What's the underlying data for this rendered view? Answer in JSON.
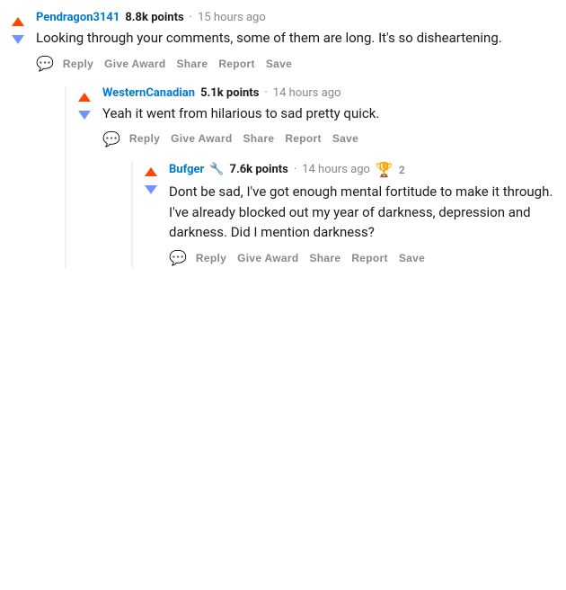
{
  "comments": [
    {
      "id": "comment1",
      "username": "Pendragon3141",
      "points": "8.8k points",
      "dot": "·",
      "timestamp": "15 hours ago",
      "text": "Looking through your comments, some of them are long. It's so disheartening.",
      "actions": [
        "Reply",
        "Give Award",
        "Share",
        "Report",
        "Save"
      ],
      "awards": [],
      "hasTool": false,
      "nested": [
        {
          "id": "comment2",
          "username": "WesternCanadian",
          "points": "5.1k points",
          "dot": "·",
          "timestamp": "14 hours ago",
          "text": "Yeah it went from hilarious to sad pretty quick.",
          "actions": [
            "Reply",
            "Give Award",
            "Share",
            "Report",
            "Save"
          ],
          "awards": [],
          "hasTool": false,
          "nested": [
            {
              "id": "comment3",
              "username": "Bufger",
              "points": "7.6k points",
              "dot": "·",
              "timestamp": "14 hours ago",
              "text": "Dont be sad, I've got enough mental fortitude to make it through. I've already blocked out my year of darkness, depression and darkness. Did I mention darkness?",
              "actions": [
                "Reply",
                "Give Award",
                "Share",
                "Report",
                "Save"
              ],
              "awards": [
                {
                  "emoji": "🏆",
                  "count": "2"
                }
              ],
              "hasTool": true,
              "nested": []
            }
          ]
        }
      ]
    }
  ],
  "icons": {
    "chat": "💬",
    "wrench": "🔧",
    "trophy": "🏆"
  }
}
